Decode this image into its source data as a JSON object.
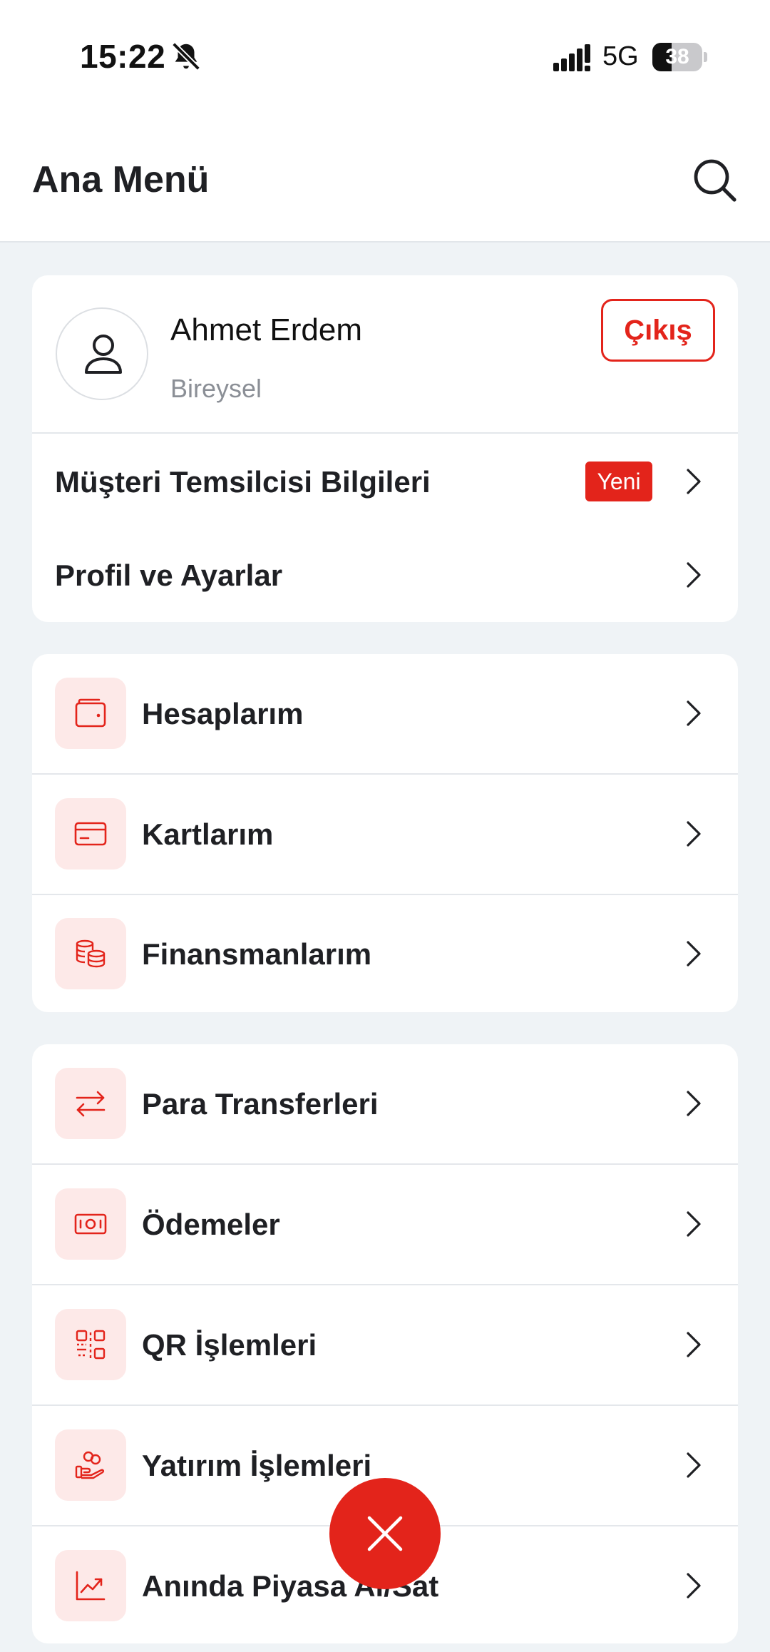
{
  "status_bar": {
    "time": "15:22",
    "network": "5G",
    "battery_level": "38",
    "battery_fraction": 0.38,
    "icons": [
      "bell-off-icon",
      "signal-icon",
      "battery-icon"
    ]
  },
  "header": {
    "title": "Ana Menü",
    "search_icon": "search-icon"
  },
  "profile": {
    "name": "Ahmet Erdem",
    "type": "Bireysel",
    "logout_label": "Çıkış",
    "avatar_icon": "user-icon"
  },
  "account_links": [
    {
      "label": "Müşteri Temsilcisi Bilgileri",
      "badge": "Yeni"
    },
    {
      "label": "Profil ve Ayarlar"
    }
  ],
  "menu_group_1": [
    {
      "label": "Hesaplarım",
      "icon": "wallet-icon"
    },
    {
      "label": "Kartlarım",
      "icon": "credit-card-icon"
    },
    {
      "label": "Finansmanlarım",
      "icon": "coins-stack-icon"
    }
  ],
  "menu_group_2": [
    {
      "label": "Para Transferleri",
      "icon": "transfer-arrows-icon"
    },
    {
      "label": "Ödemeler",
      "icon": "banknote-icon"
    },
    {
      "label": "QR İşlemleri",
      "icon": "qr-code-icon"
    },
    {
      "label": "Yatırım İşlemleri",
      "icon": "invest-hand-icon"
    },
    {
      "label": "Anında Piyasa Al/Sat",
      "icon": "chart-trend-icon"
    }
  ],
  "fab": {
    "icon": "close-icon"
  },
  "colors": {
    "accent": "#e3241b",
    "icon_bg": "#fde9e8",
    "page_bg": "#eff3f6",
    "text": "#1f2024",
    "muted": "#8b8f96"
  }
}
